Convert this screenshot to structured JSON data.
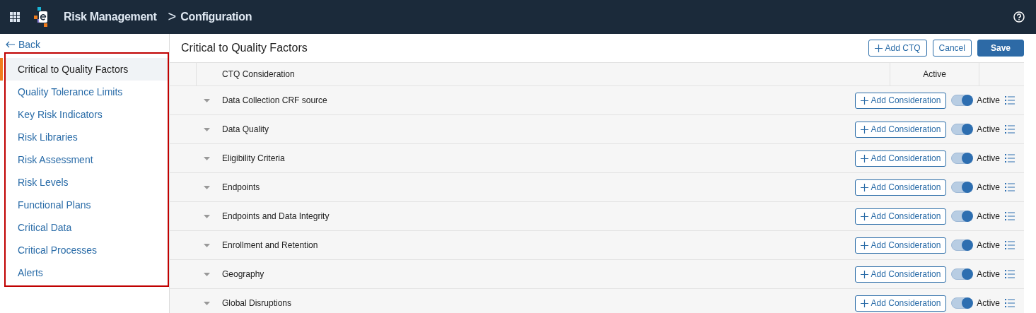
{
  "header": {
    "app_name": "Risk Management",
    "separator": ">",
    "page": "Configuration"
  },
  "sidebar": {
    "back": "Back",
    "items": [
      {
        "label": "Critical to Quality Factors",
        "selected": true
      },
      {
        "label": "Quality Tolerance Limits",
        "selected": false
      },
      {
        "label": "Key Risk Indicators",
        "selected": false
      },
      {
        "label": "Risk Libraries",
        "selected": false
      },
      {
        "label": "Risk Assessment",
        "selected": false
      },
      {
        "label": "Risk Levels",
        "selected": false
      },
      {
        "label": "Functional Plans",
        "selected": false
      },
      {
        "label": "Critical Data",
        "selected": false
      },
      {
        "label": "Critical Processes",
        "selected": false
      },
      {
        "label": "Alerts",
        "selected": false
      }
    ]
  },
  "main": {
    "title": "Critical to Quality Factors",
    "buttons": [
      {
        "kind": "add",
        "label": "Add CTQ"
      },
      {
        "kind": "secondary",
        "label": "Cancel"
      },
      {
        "kind": "primary",
        "label": "Save"
      }
    ]
  },
  "table": {
    "columns": [
      "CTQ Consideration",
      "Active"
    ],
    "rows": [
      {
        "name": "Data Collection CRF source",
        "button": "Add Consideration",
        "on": true,
        "status": "Active"
      },
      {
        "name": "Data Quality",
        "button": "Add Consideration",
        "on": true,
        "status": "Active"
      },
      {
        "name": "Eligibility Criteria",
        "button": "Add Consideration",
        "on": true,
        "status": "Active"
      },
      {
        "name": "Endpoints",
        "button": "Add Consideration",
        "on": true,
        "status": "Active"
      },
      {
        "name": "Endpoints and Data Integrity",
        "button": "Add Consideration",
        "on": true,
        "status": "Active"
      },
      {
        "name": "Enrollment and Retention",
        "button": "Add Consideration",
        "on": true,
        "status": "Active"
      },
      {
        "name": "Geography",
        "button": "Add Consideration",
        "on": true,
        "status": "Active"
      },
      {
        "name": "Global Disruptions",
        "button": "Add Consideration",
        "on": true,
        "status": "Active"
      }
    ]
  }
}
